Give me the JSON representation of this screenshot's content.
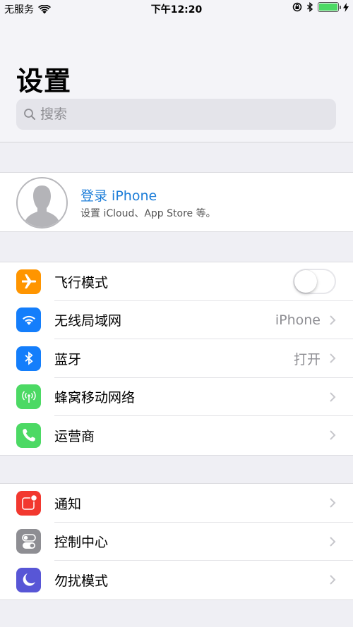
{
  "status_bar": {
    "carrier": "无服务",
    "time": "下午12:20",
    "battery_level": 1.0,
    "icons": [
      "wifi-icon",
      "orientation-lock-icon",
      "bluetooth-icon",
      "battery-icon",
      "charging-icon"
    ]
  },
  "header": {
    "title": "设置",
    "search_placeholder": "搜索"
  },
  "profile": {
    "title": "登录 iPhone",
    "subtitle": "设置 iCloud、App Store 等。"
  },
  "groups": [
    {
      "items": [
        {
          "label": "飞行模式",
          "icon": "airplane-icon",
          "color": "#ff9500",
          "type": "toggle",
          "on": false
        },
        {
          "label": "无线局域网",
          "icon": "wifi-icon",
          "color": "#147efb",
          "value": "iPhone"
        },
        {
          "label": "蓝牙",
          "icon": "bluetooth-icon",
          "color": "#147efb",
          "value": "打开"
        },
        {
          "label": "蜂窝移动网络",
          "icon": "cellular-antenna-icon",
          "color": "#4cd964",
          "value": ""
        },
        {
          "label": "运营商",
          "icon": "phone-icon",
          "color": "#4cd964",
          "value": ""
        }
      ]
    },
    {
      "items": [
        {
          "label": "通知",
          "icon": "notifications-icon",
          "color": "#f2382f",
          "value": ""
        },
        {
          "label": "控制中心",
          "icon": "control-center-icon",
          "color": "#8e8e93",
          "value": ""
        },
        {
          "label": "勿扰模式",
          "icon": "moon-icon",
          "color": "#5856d6",
          "value": ""
        }
      ]
    }
  ]
}
